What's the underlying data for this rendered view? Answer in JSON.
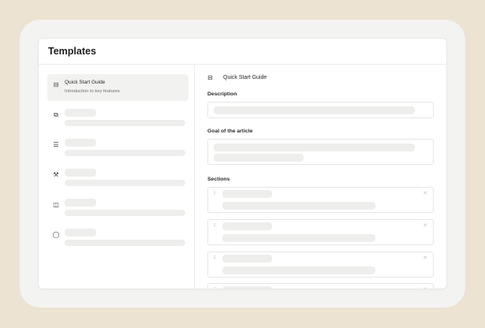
{
  "panel": {
    "title": "Templates"
  },
  "sidebar": {
    "items": [
      {
        "icon": "document-list-icon",
        "glyph": "⊟",
        "label": "Quick Start Guide",
        "description": "Introduction to key features",
        "selected": true
      },
      {
        "icon": "chat-bubbles-icon",
        "glyph": "⧉",
        "label": "",
        "description": "",
        "selected": false
      },
      {
        "icon": "checklist-icon",
        "glyph": "☰",
        "label": "",
        "description": "",
        "selected": false
      },
      {
        "icon": "wrench-icon",
        "glyph": "⚒",
        "label": "",
        "description": "",
        "selected": false
      },
      {
        "icon": "book-icon",
        "glyph": "◫",
        "label": "",
        "description": "",
        "selected": false
      },
      {
        "icon": "speech-bubble-icon",
        "glyph": "◯",
        "label": "",
        "description": "",
        "selected": false
      }
    ]
  },
  "main": {
    "heading": "Quick Start Guide",
    "description_label": "Description",
    "goal_label": "Goal of the article",
    "sections_label": "Sections",
    "sections": [
      {
        "title": "",
        "body": ""
      },
      {
        "title": "",
        "body": ""
      },
      {
        "title": "",
        "body": ""
      },
      {
        "title": "",
        "body": ""
      }
    ]
  }
}
